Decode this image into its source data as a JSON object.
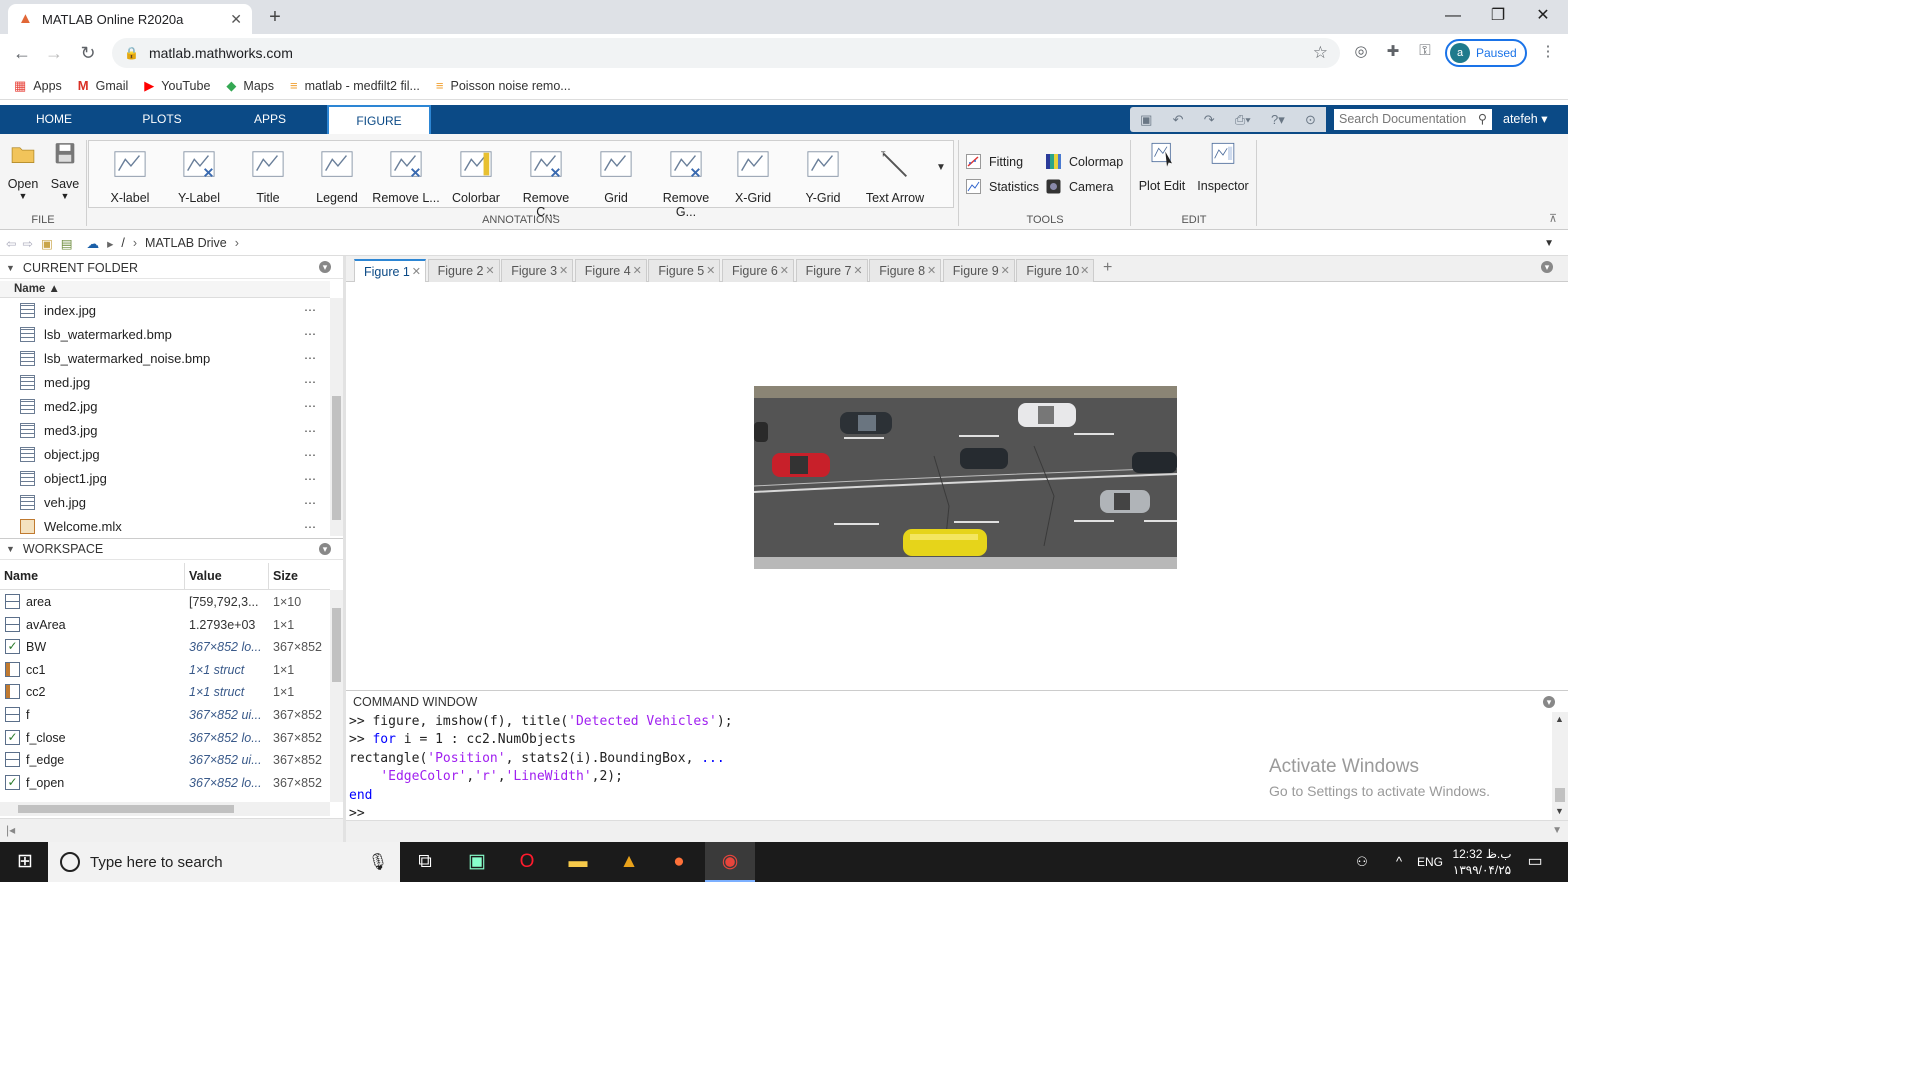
{
  "browser": {
    "tab_title": "MATLAB Online R2020a",
    "url": "matlab.mathworks.com",
    "profile_initial": "a",
    "profile_status": "Paused",
    "bookmarks": [
      "Apps",
      "Gmail",
      "YouTube",
      "Maps",
      "matlab - medfilt2 fil...",
      "Poisson noise remo..."
    ]
  },
  "matlab": {
    "tabs": [
      "HOME",
      "PLOTS",
      "APPS",
      "FIGURE"
    ],
    "active_tab": "FIGURE",
    "doc_search_placeholder": "Search Documentation",
    "user": "atefeh",
    "toolstrip": {
      "file": {
        "open": "Open",
        "save": "Save",
        "section": "FILE"
      },
      "annotations": {
        "items": [
          "X-label",
          "Y-Label",
          "Title",
          "Legend",
          "Remove L...",
          "Colorbar",
          "Remove C...",
          "Grid",
          "Remove G...",
          "X-Grid",
          "Y-Grid",
          "Text Arrow"
        ],
        "section": "ANNOTATIONS"
      },
      "tools": {
        "fitting": "Fitting",
        "statistics": "Statistics",
        "colormap": "Colormap",
        "camera": "Camera",
        "section": "TOOLS"
      },
      "edit": {
        "plot_edit": "Plot Edit",
        "inspector": "Inspector",
        "section": "EDIT"
      }
    },
    "path": {
      "root": "/",
      "folder": "MATLAB Drive"
    },
    "current_folder": {
      "title": "CURRENT FOLDER",
      "column": "Name",
      "files": [
        "index.jpg",
        "lsb_watermarked.bmp",
        "lsb_watermarked_noise.bmp",
        "med.jpg",
        "med2.jpg",
        "med3.jpg",
        "object.jpg",
        "object1.jpg",
        "veh.jpg",
        "Welcome.mlx"
      ]
    },
    "workspace": {
      "title": "WORKSPACE",
      "columns": [
        "Name",
        "Value",
        "Size"
      ],
      "rows": [
        {
          "name": "area",
          "value": "[759,792,3...",
          "size": "1×10"
        },
        {
          "name": "avArea",
          "value": "1.2793e+03",
          "size": "1×1"
        },
        {
          "name": "BW",
          "value": "367×852 lo...",
          "size": "367×852"
        },
        {
          "name": "cc1",
          "value": "1×1 struct",
          "size": "1×1"
        },
        {
          "name": "cc2",
          "value": "1×1 struct",
          "size": "1×1"
        },
        {
          "name": "f",
          "value": "367×852 ui...",
          "size": "367×852"
        },
        {
          "name": "f_close",
          "value": "367×852 lo...",
          "size": "367×852"
        },
        {
          "name": "f_edge",
          "value": "367×852 ui...",
          "size": "367×852"
        },
        {
          "name": "f_open",
          "value": "367×852 lo...",
          "size": "367×852"
        }
      ]
    },
    "figure_tabs": [
      "Figure 1",
      "Figure 2",
      "Figure 3",
      "Figure 4",
      "Figure 5",
      "Figure 6",
      "Figure 7",
      "Figure 8",
      "Figure 9",
      "Figure 10"
    ],
    "active_figure": "Figure 1",
    "command_window": {
      "title": "COMMAND WINDOW",
      "prompt": ">>",
      "line1_code": " figure, imshow(f), title(",
      "line1_str": "'Detected Vehicles'",
      "line1_end": ");",
      "line2_kw": "for",
      "line2_code": " i = 1 : cc2.NumObjects",
      "line3_code": "rectangle(",
      "line3_str": "'Position'",
      "line3_code2": ", stats2(i).BoundingBox, ",
      "line3_cont": "...",
      "line4_str1": "'EdgeColor'",
      "line4_str2": "'r'",
      "line4_str3": "'LineWidth'",
      "line4_end": ",2);",
      "line5_kw": "end"
    }
  },
  "watermark": {
    "line1": "Activate Windows",
    "line2": "Go to Settings to activate Windows."
  },
  "taskbar": {
    "search_placeholder": "Type here to search",
    "language": "ENG",
    "time": "12:32 ب.ظ",
    "date": "۱۳۹۹/۰۴/۲۵"
  }
}
